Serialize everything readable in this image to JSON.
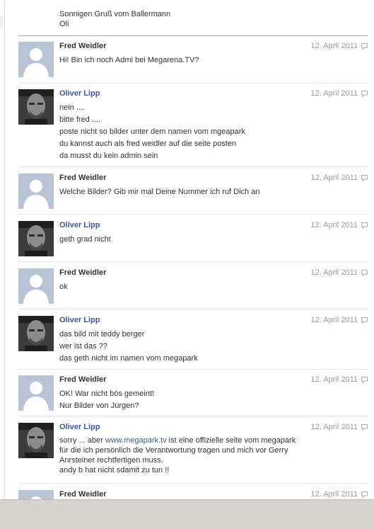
{
  "preface": {
    "line1": "Sonnigen Gruß vom Ballermann",
    "line2": "Oli"
  },
  "colors": {
    "fred_name": "#333333",
    "oliver_name": "#3b5998",
    "link": "#3b5998",
    "date": "#999999"
  },
  "icons": {
    "reply": "speech-bubble-icon",
    "fred_avatar": "default-profile-silhouette",
    "oliver_avatar": "profile-photo-bald-man"
  },
  "messages": [
    {
      "author": "Fred Weidler",
      "date": "12. April 2011",
      "lines": [
        "Hi! Bin ich noch Admi bei Megarena.TV?"
      ]
    },
    {
      "author": "Oliver Lipp",
      "date": "12. April 2011",
      "lines": [
        "nein ....",
        "bitte fred ....",
        "poste nicht so bilder unter dem namen vom mgeapark",
        "du kannst auch als fred weidler auf die seite posten",
        "da musst du kein admin sein"
      ]
    },
    {
      "author": "Fred Weidler",
      "date": "12. April 2011",
      "lines": [
        "Welche Bilder? Gib mir mal Deine Nummer ich ruf Dich an"
      ]
    },
    {
      "author": "Oliver Lipp",
      "date": "12. April 2011",
      "lines": [
        "geth grad nicht"
      ]
    },
    {
      "author": "Fred Weidler",
      "date": "12. April 2011",
      "lines": [
        "ok"
      ]
    },
    {
      "author": "Oliver Lipp",
      "date": "12. April 2011",
      "lines": [
        "das bild mit teddy berger",
        "wer ist das ??",
        "das geth nicht im namen vom megapark"
      ]
    },
    {
      "author": "Fred Weidler",
      "date": "12. April 2011",
      "lines": [
        "OK! War nicht bös gemeint!",
        "Nur Bilder von Jürgen?"
      ]
    },
    {
      "author": "Oliver Lipp",
      "date": "12. April 2011",
      "prefix": "sorry ... aber ",
      "link": "www.megapark.tv",
      "suffix": " ist eine offizielle seite vom megapark für die ich persönlich die Verantwortung tragen und mich vor Gerry Anrsteiner rechtfertigen muss.",
      "last_line": "andy b hat nicht sdamit zu tun !!"
    },
    {
      "author": "Fred Weidler",
      "date": "12. April 2011",
      "lines": []
    }
  ]
}
